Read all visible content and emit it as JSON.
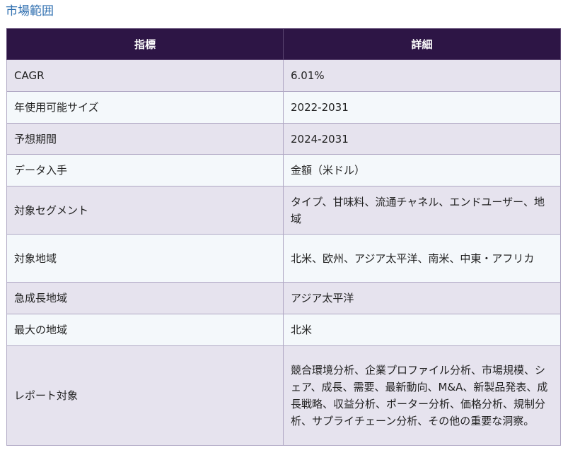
{
  "section_title": "市場範囲",
  "table": {
    "headers": [
      "指標",
      "詳細"
    ],
    "rows": [
      {
        "label": "CAGR",
        "value": "6.01%"
      },
      {
        "label": "年使用可能サイズ",
        "value": "2022-2031"
      },
      {
        "label": "予想期間",
        "value": "2024-2031"
      },
      {
        "label": "データ入手",
        "value": "金額（米ドル）"
      },
      {
        "label": "対象セグメント",
        "value": "タイプ、甘味料、流通チャネル、エンドユーザー、地域"
      },
      {
        "label": "対象地域",
        "value": "北米、欧州、アジア太平洋、南米、中東・アフリカ"
      },
      {
        "label": "急成長地域",
        "value": "アジア太平洋"
      },
      {
        "label": "最大の地域",
        "value": "北米"
      },
      {
        "label": "レポート対象",
        "value": "競合環境分析、企業プロファイル分析、市場規模、シェア、成長、需要、最新動向、M&A、新製品発表、成長戦略、収益分析、ポーター分析、価格分析、規制分析、サプライチェーン分析、その他の重要な洞察。"
      }
    ]
  }
}
